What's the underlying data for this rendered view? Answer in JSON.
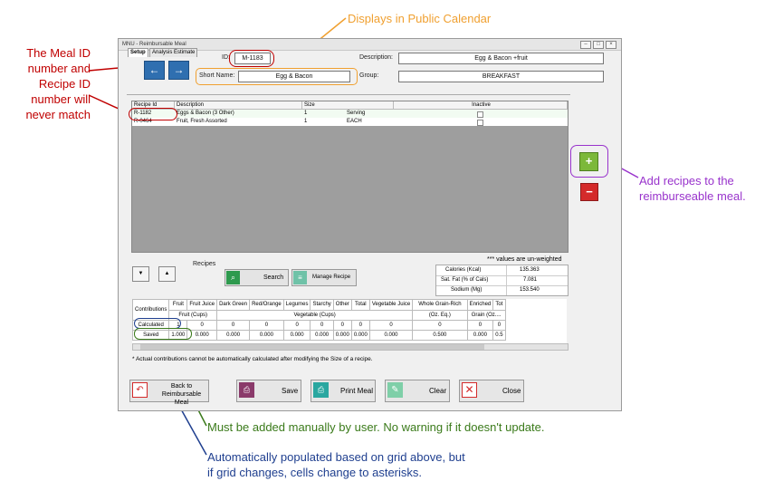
{
  "window": {
    "title": "MNU - Reimbursable Meal"
  },
  "header": {
    "id_label": "ID:",
    "id_value": "M-1183",
    "short_name_label": "Short Name:",
    "short_name_value": "Egg & Bacon",
    "description_label": "Description:",
    "description_value": "Egg & Bacon +fruit",
    "group_label": "Group:",
    "group_value": "BREAKFAST"
  },
  "tabs": [
    {
      "label": "Setup"
    },
    {
      "label": "Analysis Estimate"
    }
  ],
  "recipe_grid": {
    "columns": [
      "Recipe Id",
      "Description",
      "Size",
      "Inactive"
    ],
    "rows": [
      {
        "id": "R-1182",
        "description": "Eggs & Bacon (3 Other)",
        "size": "1",
        "unit": "Serving"
      },
      {
        "id": "R-0464",
        "description": "Fruit, Fresh Assorted",
        "size": "1",
        "unit": "EACH"
      }
    ]
  },
  "recipes_section": {
    "label": "Recipes",
    "search": "Search",
    "manage": "Manage Recipe"
  },
  "nutrients": {
    "note": "*** values are un-weighted",
    "rows": [
      {
        "label": "Calories (Kcal)",
        "value": "135.363"
      },
      {
        "label": "Sat. Fat (% of Cals)",
        "value": "7.081"
      },
      {
        "label": "Sodium (Mg)",
        "value": "153.540"
      }
    ]
  },
  "contributions": {
    "label": "Contributions",
    "columns": [
      "Fruit",
      "Fruit Juice",
      "Dark Green",
      "Red/Orange",
      "Legumes",
      "Starchy",
      "Other",
      "Total",
      "Vegetable Juice",
      "Whole Grain-Rich",
      "Enriched",
      "Tot"
    ],
    "groups": [
      "Fruit (Cups)",
      "Vegetable (Cups)",
      "(Oz. Eq.)",
      "Grain (Oz...."
    ],
    "calculated_label": "Calculated",
    "calculated": [
      "1",
      "0",
      "0",
      "0",
      "0",
      "0",
      "0",
      "0",
      "0",
      "0",
      "0",
      "0"
    ],
    "saved_label": "Saved",
    "saved": [
      "1.000",
      "0.000",
      "0.000",
      "0.000",
      "0.000",
      "0.000",
      "0.000",
      "0.000",
      "0.000",
      "0.500",
      "0.000",
      "0.5"
    ],
    "footnote": "* Actual contributions cannot be automatically calculated after modifying the Size of a recipe."
  },
  "buttons": {
    "back": "Back to\nReimbursable Meal",
    "save": "Save",
    "print": "Print Meal",
    "clear": "Clear",
    "close": "Close",
    "add": "+",
    "remove": "−"
  },
  "annotations": {
    "public_calendar": "Displays in Public Calendar",
    "meal_id": "The Meal ID\nnumber and\nRecipe ID\nnumber will\nnever match",
    "add_recipes": "Add recipes to the\nreimburseable meal.",
    "manual": "Must be added manually by user.  No warning if it doesn't update.",
    "auto": "Automatically populated based on grid above, but\nif grid changes, cells change to asterisks."
  },
  "colors": {
    "meal_id_annotation": "#c00000",
    "calendar_annotation": "#f0a030",
    "add_annotation": "#9933cc",
    "manual_annotation": "#3a7a1a",
    "auto_annotation": "#1f3f8f"
  }
}
